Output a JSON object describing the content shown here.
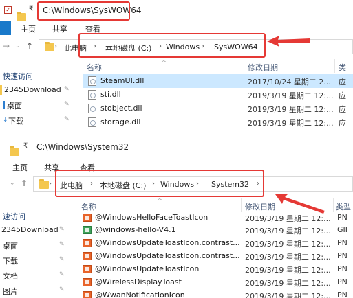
{
  "colors": {
    "accent": "#1979ca",
    "highlight_box": "#e53935",
    "selection": "#cce8ff"
  },
  "top_window": {
    "title": "C:\\Windows\\SysWOW64",
    "ribbon": {
      "file": "",
      "tabs": [
        "主页",
        "共享",
        "查看"
      ]
    },
    "address": {
      "crumbs": [
        "此电脑",
        "本地磁盘 (C:)",
        "Windows",
        "SysWOW64"
      ]
    },
    "columns": {
      "name": "名称",
      "date": "修改日期",
      "type": "类"
    },
    "nav": [
      {
        "label": "快速访问",
        "pinned": false
      },
      {
        "label": "2345Download",
        "pinned": true
      },
      {
        "label": "桌面",
        "pinned": true
      },
      {
        "label": "下载",
        "pinned": true
      }
    ],
    "files": [
      {
        "name": "SteamUI.dll",
        "date": "2017/10/24 星期二 2...",
        "type": "应"
      },
      {
        "name": "sti.dll",
        "date": "2019/3/19 星期二 12:...",
        "type": "应"
      },
      {
        "name": "stobject.dll",
        "date": "2019/3/19 星期二 12:...",
        "type": "应"
      },
      {
        "name": "storage.dll",
        "date": "2019/3/19 星期二 12:...",
        "type": "应"
      }
    ]
  },
  "bottom_window": {
    "title": "C:\\Windows\\System32",
    "ribbon": {
      "file": "",
      "tabs": [
        "主页",
        "共享",
        "查看"
      ]
    },
    "address": {
      "crumbs": [
        "此电脑",
        "本地磁盘 (C:)",
        "Windows",
        "System32"
      ]
    },
    "columns": {
      "name": "名称",
      "date": "修改日期",
      "type": "类型"
    },
    "nav": [
      {
        "label": "速访问",
        "pinned": false
      },
      {
        "label": "2345Download",
        "pinned": true
      },
      {
        "label": "桌面",
        "pinned": true
      },
      {
        "label": "下载",
        "pinned": true
      },
      {
        "label": "文档",
        "pinned": true
      },
      {
        "label": "图片",
        "pinned": true
      }
    ],
    "files": [
      {
        "name": "@WindowsHelloFaceToastIcon",
        "date": "2019/3/19 星期二 12:...",
        "type": "PN",
        "icon": "png-image-icon"
      },
      {
        "name": "@windows-hello-V4.1",
        "date": "2019/3/19 星期二 12:...",
        "type": "GII",
        "icon": "gif-image-icon"
      },
      {
        "name": "@WindowsUpdateToastIcon.contrast...",
        "date": "2019/3/19 星期二 12:...",
        "type": "PN",
        "icon": "png-image-icon"
      },
      {
        "name": "@WindowsUpdateToastIcon.contrast...",
        "date": "2019/3/19 星期二 12:...",
        "type": "PN",
        "icon": "png-image-icon"
      },
      {
        "name": "@WindowsUpdateToastIcon",
        "date": "2019/3/19 星期二 12:...",
        "type": "PN",
        "icon": "png-image-icon"
      },
      {
        "name": "@WirelessDisplayToast",
        "date": "2019/3/19 星期二 12:...",
        "type": "PN",
        "icon": "png-image-icon"
      },
      {
        "name": "@WwanNotificationIcon",
        "date": "2019/3/19 星期二 12:...",
        "type": "PN",
        "icon": "png-image-icon"
      }
    ]
  }
}
